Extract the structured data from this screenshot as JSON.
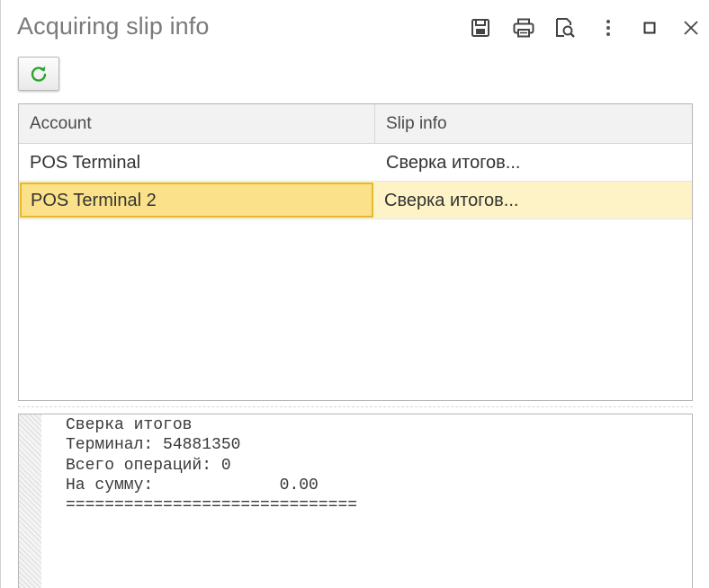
{
  "window": {
    "title": "Acquiring slip info",
    "toolbar_icons": [
      "save-icon",
      "print-icon",
      "preview-icon",
      "more-icon",
      "maximize-icon",
      "close-icon"
    ]
  },
  "actions": {
    "refresh_icon": "refresh-icon",
    "refresh_color": "#2ea32e"
  },
  "table": {
    "columns": [
      "Account",
      "Slip info"
    ],
    "rows": [
      {
        "account": "POS Terminal",
        "slip_info": "Сверка итогов..."
      },
      {
        "account": "POS Terminal 2",
        "slip_info": "Сверка итогов..."
      }
    ],
    "selected_row": 1
  },
  "slip": {
    "lines": [
      "Сверка итогов",
      "Терминал: 54881350",
      "Всего операций: 0",
      "На сумму:             0.00",
      "=============================="
    ]
  },
  "colors": {
    "selection_row": "#fdf3c6",
    "selection_cell": "#fbe28a",
    "selection_border": "#e6b92c"
  }
}
